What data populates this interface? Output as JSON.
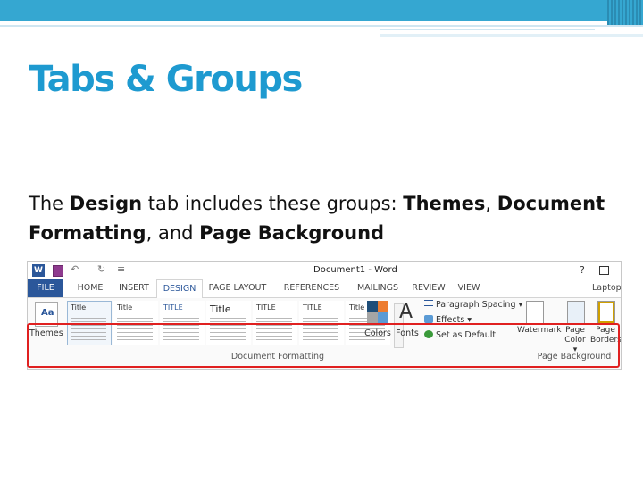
{
  "slide": {
    "title": "Tabs & Groups",
    "body": {
      "t1": "The ",
      "b1": "Design",
      "t2": " tab includes these groups: ",
      "b2": "Themes",
      "t3": ", ",
      "b3": "Document Formatting",
      "t4": ", and ",
      "b4": "Page Background"
    }
  },
  "ribbon": {
    "app_icon": "W",
    "window_title": "Document1 - Word",
    "help": "?",
    "undo_glyph": "↶",
    "redo_glyph": "↻",
    "qat_more": "≡",
    "tabs": [
      "FILE",
      "HOME",
      "INSERT",
      "DESIGN",
      "PAGE LAYOUT",
      "REFERENCES",
      "MAILINGS",
      "REVIEW",
      "VIEW"
    ],
    "account": "Laptop",
    "themes": {
      "icon_text": "Aa",
      "label": "Themes"
    },
    "styles": [
      {
        "title": "Title",
        "sub": "Heading 1"
      },
      {
        "title": "Title",
        "sub": "Heading 1"
      },
      {
        "title": "TITLE",
        "sub": "HEADING 1"
      },
      {
        "title": "Title",
        "sub": "Heading 1"
      },
      {
        "title": "TITLE",
        "sub": "HEADING 1"
      },
      {
        "title": "TITLE",
        "sub": "HEADING 1"
      },
      {
        "title": "Title",
        "sub": "HEADING 1"
      }
    ],
    "colors_label": "Colors",
    "fonts": {
      "glyph": "A",
      "label": "Fonts"
    },
    "paragraph_spacing": "Paragraph Spacing ▾",
    "effects": "Effects ▾",
    "set_default": "Set as Default",
    "watermark": "Watermark",
    "page_color": "Page Color ▾",
    "page_borders": "Page Borders",
    "group_document_formatting": "Document Formatting",
    "group_page_background": "Page Background"
  },
  "colors": {
    "title": "#1e9ad0",
    "topbar": "#35a7d1",
    "highlight": "#e02020",
    "word_blue": "#2b579a"
  }
}
